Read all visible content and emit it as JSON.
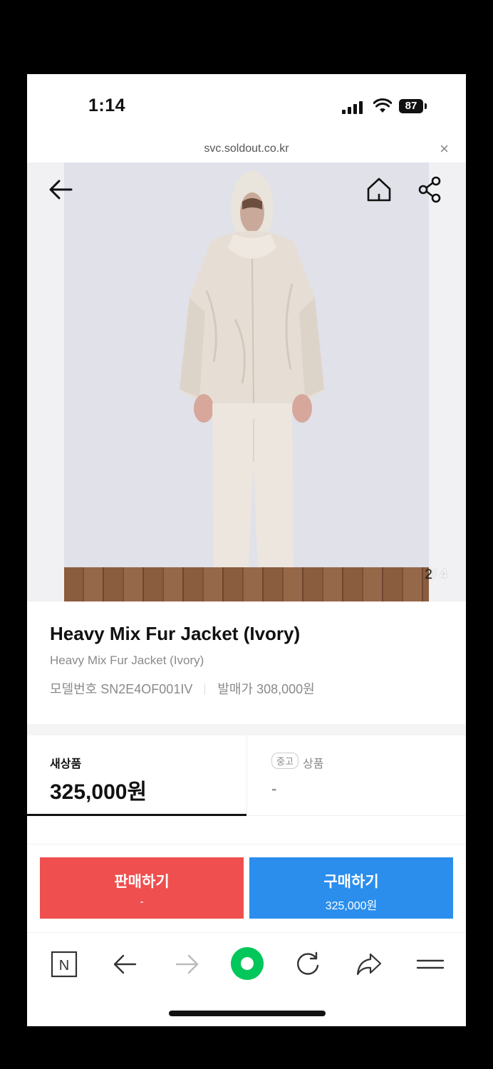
{
  "status_bar": {
    "time": "1:14",
    "battery": "87"
  },
  "browser_top": {
    "url": "svc.soldout.co.kr",
    "close": "×"
  },
  "gallery": {
    "current": "2",
    "separator": "/",
    "total": "4"
  },
  "product": {
    "title": "Heavy Mix Fur Jacket (Ivory)",
    "subtitle": "Heavy Mix Fur Jacket (Ivory)",
    "model_label": "모델번호",
    "model_number": "SN2E4OF001IV",
    "release_label": "발매가",
    "release_price": "308,000원"
  },
  "price_tabs": {
    "new": {
      "label": "새상품",
      "price": "325,000원"
    },
    "used": {
      "badge": "중고",
      "label": "상품",
      "price": "-"
    }
  },
  "actions": {
    "sell": {
      "label": "판매하기",
      "price": "-"
    },
    "buy": {
      "label": "구매하기",
      "price": "325,000원"
    }
  },
  "browser_bar": {
    "naver_logo": "N"
  },
  "colors": {
    "sell": "#ef4f4f",
    "buy": "#2b8eed",
    "naver_green": "#03c75a"
  },
  "icons": [
    "back-arrow-icon",
    "home-icon",
    "share-icon",
    "naver-icon",
    "browser-back-icon",
    "browser-forward-icon",
    "naver-green-button-icon",
    "refresh-icon",
    "share-forward-icon",
    "menu-icon"
  ]
}
